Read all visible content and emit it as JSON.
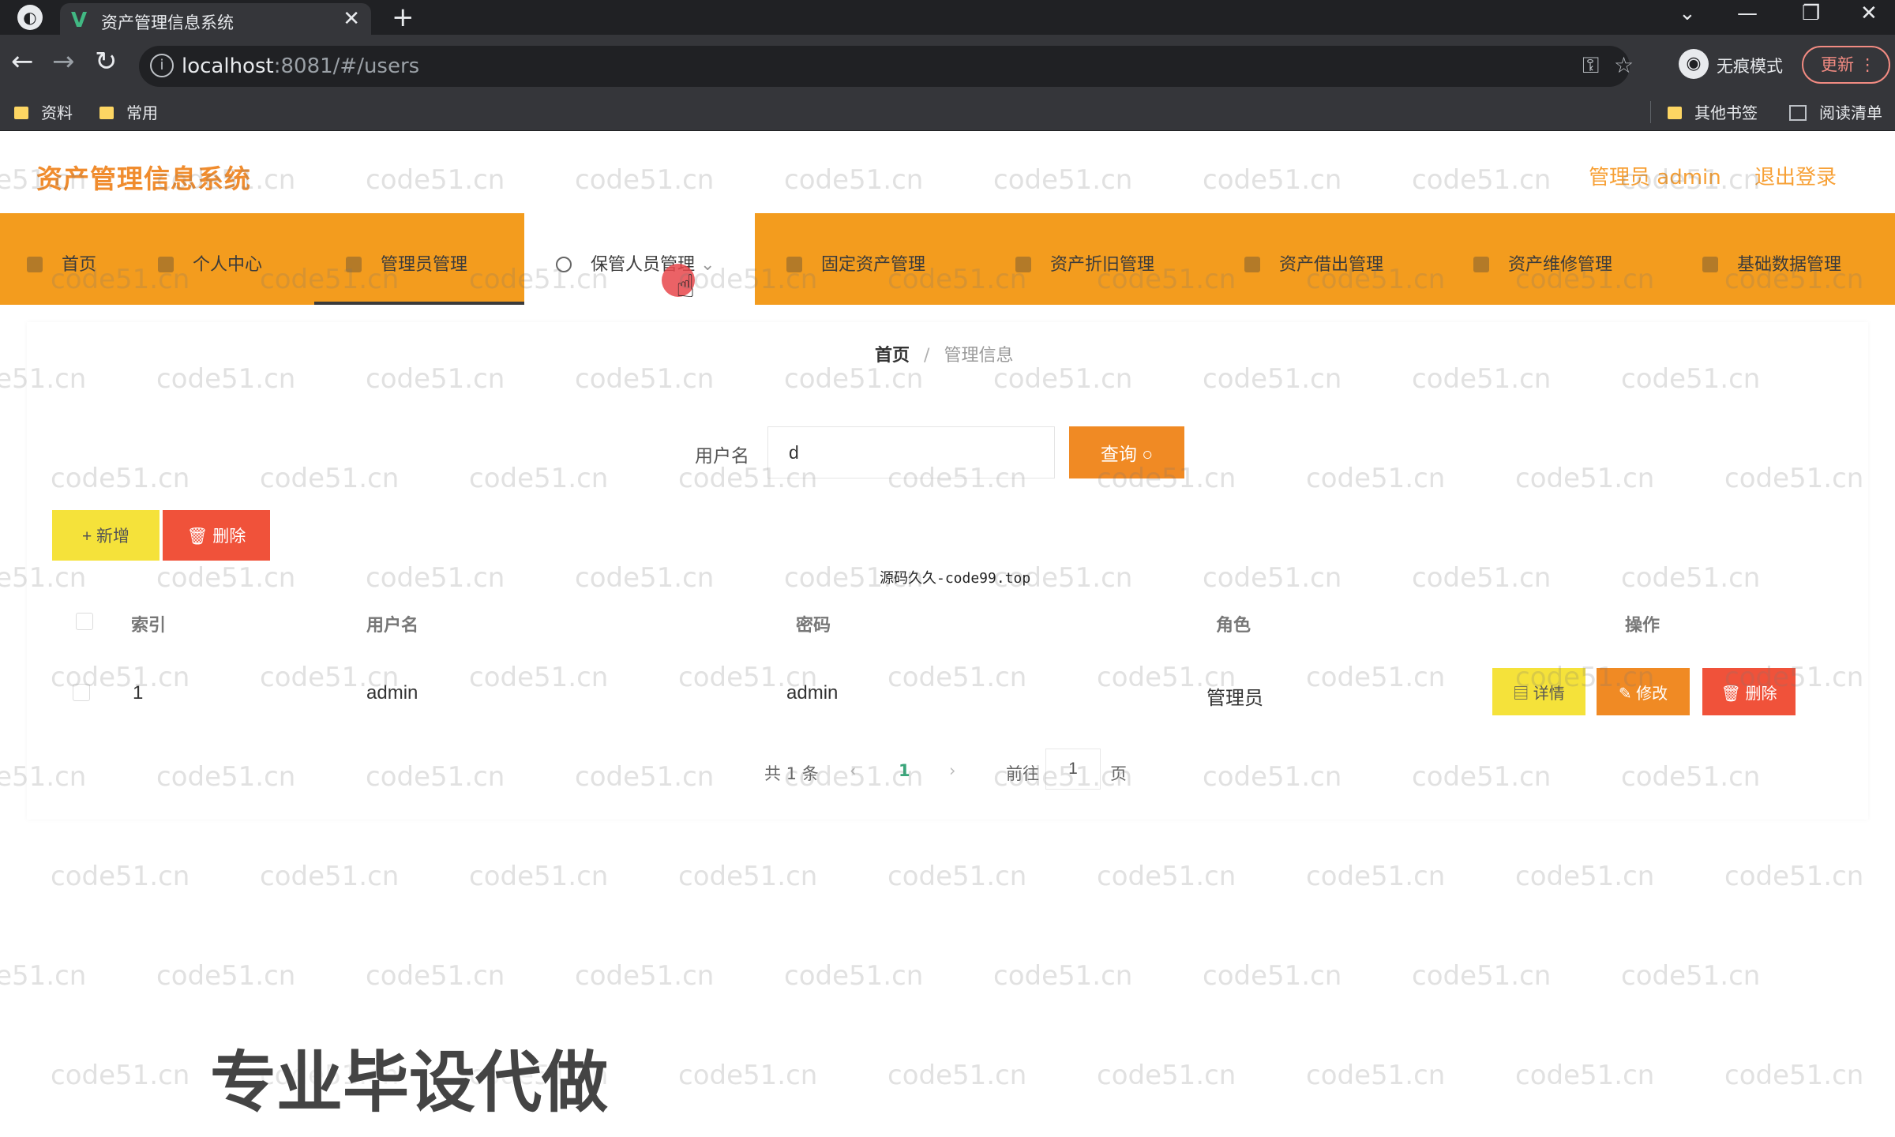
{
  "browser": {
    "tab_title": "资产管理信息系统",
    "tab_favicon": "V",
    "url_host": "localhost",
    "url_rest": ":8081/#/users",
    "incognito_label": "无痕模式",
    "update_label": "更新",
    "bookmarks": [
      "资料",
      "常用"
    ],
    "other_bookmarks": "其他书签",
    "reading_list": "阅读清单"
  },
  "header": {
    "system_title": "资产管理信息系统",
    "user_info": "管理员 admin",
    "logout": "退出登录"
  },
  "menu": {
    "items": [
      "首页",
      "个人中心",
      "管理员管理",
      "保管人员管理",
      "固定资产管理",
      "资产折旧管理",
      "资产借出管理",
      "资产维修管理",
      "基础数据管理"
    ],
    "active": "保管人员管理"
  },
  "breadcrumb": {
    "home": "首页",
    "sep": "/",
    "current": "管理信息"
  },
  "search": {
    "label": "用户名",
    "value": "d",
    "button": "查询"
  },
  "actions": {
    "add": "+ 新增",
    "delete": "删除"
  },
  "center_note": "源码久久-code99.top",
  "table": {
    "headers": [
      "索引",
      "用户名",
      "密码",
      "角色",
      "操作"
    ],
    "rows": [
      {
        "index": "1",
        "username": "admin",
        "password": "admin",
        "role": "管理员"
      }
    ],
    "row_actions": {
      "detail": "详情",
      "edit": "修改",
      "delete": "删除"
    }
  },
  "pagination": {
    "total": "共 1 条",
    "current_page": "1",
    "goto_label": "前往",
    "goto_value": "1",
    "page_suffix": "页"
  },
  "watermark_text": "code51.cn",
  "promo_text": "专业毕设代做",
  "colors": {
    "menu_bg": "#f39c1e",
    "title": "#f08c2e",
    "query": "#f08a24",
    "add": "#f5e23a",
    "delete": "#f0523a"
  }
}
